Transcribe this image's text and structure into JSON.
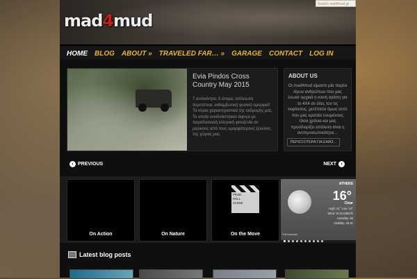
{
  "header": {
    "logo_left": "mad",
    "logo_num": "4",
    "logo_right": "mud",
    "search_placeholder": "Search mad4mud.gr"
  },
  "nav": {
    "items": [
      "HOME",
      "BLOG",
      "ABOUT »",
      "TRAVELED FAR… »",
      "GARAGE",
      "CONTACT",
      "LOG IN"
    ],
    "active": "HOME",
    "color_accent": "#e8b432"
  },
  "featured": {
    "title": "Evia Pindos Cross Country May 2015",
    "excerpt": "7 αυτοκίνητα, 5 άτομα, ατέλειωτη περιπέτεια, εκθαμβωτική φυσική ομορφιά! Τα κύρια χαρακτηριστικά της εκδρομής μας. Το οποίο συνδυάστηκαν άψογα με παραδοσιακή ελληνική φιλοξενία σε μερικούς από τους ομορφότερους ξενώνες της χώρας μας."
  },
  "about": {
    "heading": "ABOUT US",
    "text": "Οι mad4mud είμαστε μία παρέα λίγων ανθρώπων που μας ένωσε αρχικά η κοινή αγάπη για το 4X4 σε όλες του τις εκφάνσεις, μετέπειτα όμως αυτό που μας κρατάει ενωμένους τόσα χρόνια και μας προσδιορίζει απόλυτα είναι η αντιπροσωπικότητα…",
    "more": "ΠΕΡΙΣΣΟΤΕΡΑ ΓΙΑ ΕΜΑΣ..."
  },
  "pager": {
    "prev": "PREVIOUS",
    "next": "NEXT"
  },
  "carousel": {
    "cards": [
      "On Action",
      "On Nature",
      "On the Move"
    ],
    "clapboard_lines": [
      "PROD.",
      "ROLL",
      "SCENE"
    ],
    "weather": {
      "city": "ATHENS",
      "condition_label": "Clear",
      "temperature": "16°",
      "description": "Clear",
      "high_low": "High: 21° Low: 10°",
      "wind": "Wind: W 22.53km/h",
      "humidity": "Humidity: 69",
      "visibility": "Visibility: 25.91",
      "source": "Full forecast"
    },
    "dots_count": 10,
    "active_dot": 0
  },
  "latest": {
    "title": "Latest blog posts"
  }
}
